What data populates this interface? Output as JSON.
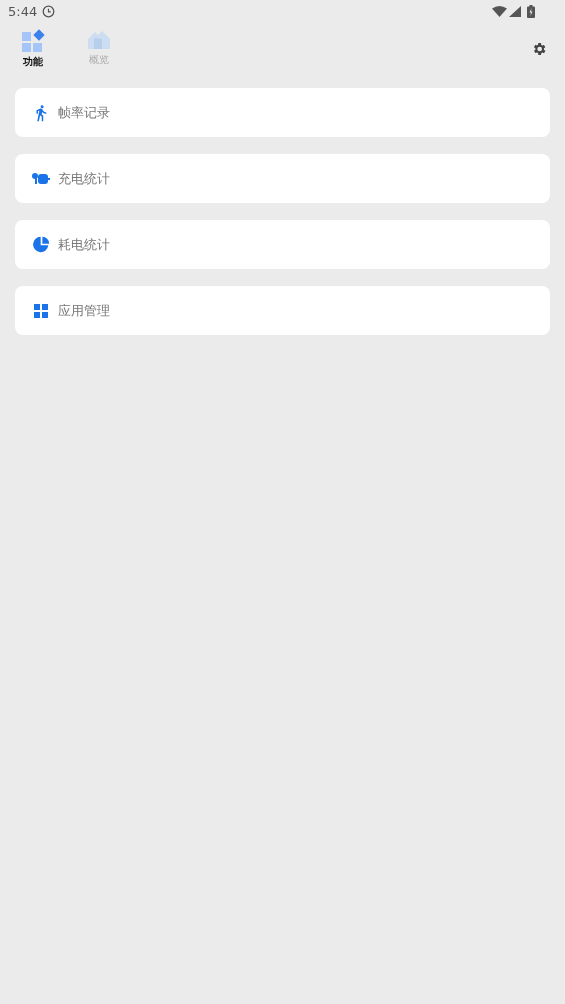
{
  "status_bar": {
    "time": "5:44"
  },
  "tabs": [
    {
      "label": "功能",
      "selected": true,
      "kind": "grid"
    },
    {
      "label": "概览",
      "selected": false,
      "kind": "house"
    }
  ],
  "items": [
    {
      "label": "帧率记录",
      "kind": "run"
    },
    {
      "label": "充电统计",
      "kind": "plug"
    },
    {
      "label": "耗电统计",
      "kind": "pie"
    },
    {
      "label": "应用管理",
      "kind": "apps"
    }
  ]
}
